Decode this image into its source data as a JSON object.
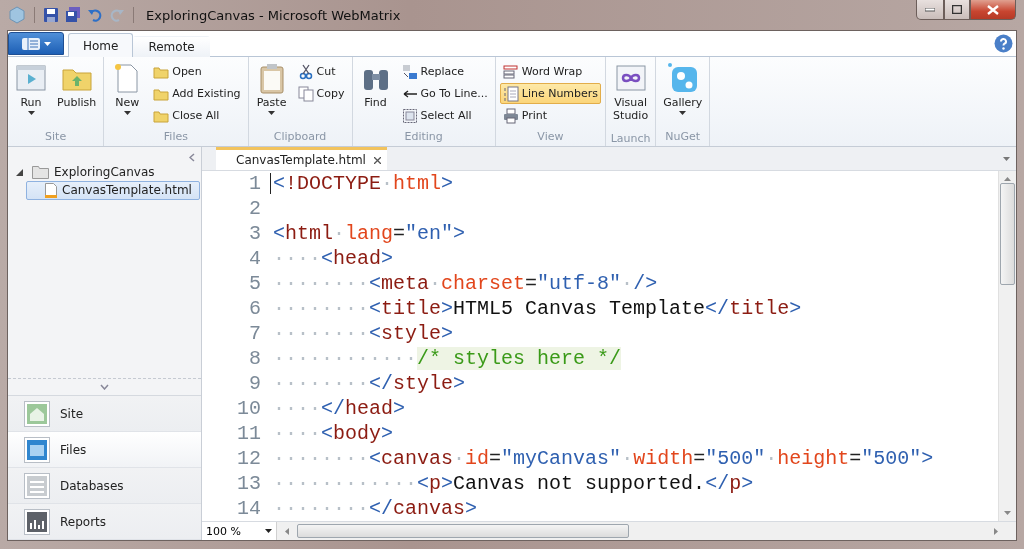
{
  "window": {
    "title": "ExploringCanvas - Microsoft WebMatrix"
  },
  "ribbon_tabs": [
    {
      "label": "Home",
      "selected": true
    },
    {
      "label": "Remote",
      "selected": false
    }
  ],
  "ribbon_groups": [
    {
      "label": "Site",
      "items": [
        {
          "kind": "large",
          "label": "Run",
          "dropdown": true
        },
        {
          "kind": "large",
          "label": "Publish",
          "dropdown": false
        }
      ]
    },
    {
      "label": "Files",
      "items": [
        {
          "kind": "large",
          "label": "New",
          "dropdown": true
        },
        {
          "kind": "stack",
          "entries": [
            {
              "label": "Open",
              "on": false
            },
            {
              "label": "Add Existing",
              "on": false
            },
            {
              "label": "Close All",
              "on": false
            }
          ]
        }
      ]
    },
    {
      "label": "Clipboard",
      "items": [
        {
          "kind": "large",
          "label": "Paste",
          "dropdown": true
        },
        {
          "kind": "stack",
          "entries": [
            {
              "label": "Cut",
              "on": false
            },
            {
              "label": "Copy",
              "on": false
            }
          ]
        }
      ]
    },
    {
      "label": "Editing",
      "items": [
        {
          "kind": "large",
          "label": "Find",
          "dropdown": false
        },
        {
          "kind": "stack",
          "entries": [
            {
              "label": "Replace",
              "on": false
            },
            {
              "label": "Go To Line...",
              "on": false
            },
            {
              "label": "Select All",
              "on": false
            }
          ]
        }
      ]
    },
    {
      "label": "View",
      "items": [
        {
          "kind": "stack",
          "entries": [
            {
              "label": "Word Wrap",
              "on": false
            },
            {
              "label": "Line Numbers",
              "on": true
            },
            {
              "label": "Print",
              "on": false
            }
          ]
        }
      ]
    },
    {
      "label": "Launch",
      "items": [
        {
          "kind": "large",
          "label": "Visual\nStudio",
          "dropdown": false
        }
      ]
    },
    {
      "label": "NuGet",
      "items": [
        {
          "kind": "large",
          "label": "Gallery",
          "dropdown": true
        }
      ]
    }
  ],
  "tree": [
    {
      "label": "ExploringCanvas",
      "expanded": true,
      "selected": false,
      "children": [
        {
          "label": "CanvasTemplate.html",
          "selected": true
        }
      ]
    }
  ],
  "workspaces": [
    {
      "label": "Site",
      "selected": false
    },
    {
      "label": "Files",
      "selected": true
    },
    {
      "label": "Databases",
      "selected": false
    },
    {
      "label": "Reports",
      "selected": false
    }
  ],
  "editor_tabs": [
    {
      "label": "CanvasTemplate.html",
      "selected": true
    }
  ],
  "code_lines": [
    {
      "number": "1",
      "tokens": [
        {
          "kind": "bracket",
          "text": "<"
        },
        {
          "kind": "tag",
          "text": "!DOCTYPE"
        },
        {
          "kind": "space",
          "text": "·"
        },
        {
          "kind": "attr",
          "text": "html"
        },
        {
          "kind": "bracket",
          "text": ">"
        }
      ]
    },
    {
      "number": "2"
    },
    {
      "number": "3",
      "tokens": [
        {
          "kind": "bracket",
          "text": "<"
        },
        {
          "kind": "tag",
          "text": "html"
        },
        {
          "kind": "space",
          "text": "·"
        },
        {
          "kind": "attr",
          "text": "lang"
        },
        {
          "kind": "eq",
          "text": "="
        },
        {
          "kind": "value",
          "text": "\"en\""
        },
        {
          "kind": "bracket",
          "text": ">"
        }
      ]
    },
    {
      "number": "4",
      "tokens": [
        {
          "kind": "space",
          "text": "····"
        },
        {
          "kind": "bracket",
          "text": "<"
        },
        {
          "kind": "tag",
          "text": "head"
        },
        {
          "kind": "bracket",
          "text": ">"
        }
      ]
    },
    {
      "number": "5",
      "tokens": [
        {
          "kind": "space",
          "text": "········"
        },
        {
          "kind": "bracket",
          "text": "<"
        },
        {
          "kind": "tag",
          "text": "meta"
        },
        {
          "kind": "space",
          "text": "·"
        },
        {
          "kind": "attr",
          "text": "charset"
        },
        {
          "kind": "eq",
          "text": "="
        },
        {
          "kind": "value",
          "text": "\"utf-8\""
        },
        {
          "kind": "space",
          "text": "·"
        },
        {
          "kind": "bracket",
          "text": "/>"
        }
      ]
    },
    {
      "number": "6",
      "tokens": [
        {
          "kind": "space",
          "text": "········"
        },
        {
          "kind": "bracket",
          "text": "<"
        },
        {
          "kind": "tag",
          "text": "title"
        },
        {
          "kind": "bracket",
          "text": ">"
        },
        {
          "kind": "text",
          "text": "HTML5 Canvas Template"
        },
        {
          "kind": "bracket",
          "text": "</"
        },
        {
          "kind": "tag",
          "text": "title"
        },
        {
          "kind": "bracket",
          "text": ">"
        }
      ]
    },
    {
      "number": "7",
      "tokens": [
        {
          "kind": "space",
          "text": "········"
        },
        {
          "kind": "bracket",
          "text": "<"
        },
        {
          "kind": "tag",
          "text": "style"
        },
        {
          "kind": "bracket",
          "text": ">"
        }
      ]
    },
    {
      "number": "8",
      "tokens": [
        {
          "kind": "space",
          "text": "············"
        },
        {
          "kind": "comment",
          "text": "/* styles here */"
        }
      ]
    },
    {
      "number": "9",
      "tokens": [
        {
          "kind": "space",
          "text": "········"
        },
        {
          "kind": "bracket",
          "text": "</"
        },
        {
          "kind": "tag",
          "text": "style"
        },
        {
          "kind": "bracket",
          "text": ">"
        }
      ]
    },
    {
      "number": "10",
      "tokens": [
        {
          "kind": "space",
          "text": "····"
        },
        {
          "kind": "bracket",
          "text": "</"
        },
        {
          "kind": "tag",
          "text": "head"
        },
        {
          "kind": "bracket",
          "text": ">"
        }
      ]
    },
    {
      "number": "11",
      "tokens": [
        {
          "kind": "space",
          "text": "····"
        },
        {
          "kind": "bracket",
          "text": "<"
        },
        {
          "kind": "tag",
          "text": "body"
        },
        {
          "kind": "bracket",
          "text": ">"
        }
      ]
    },
    {
      "number": "12",
      "tokens": [
        {
          "kind": "space",
          "text": "········"
        },
        {
          "kind": "bracket",
          "text": "<"
        },
        {
          "kind": "tag",
          "text": "canvas"
        },
        {
          "kind": "space",
          "text": "·"
        },
        {
          "kind": "attr",
          "text": "id"
        },
        {
          "kind": "eq",
          "text": "="
        },
        {
          "kind": "value",
          "text": "\"myCanvas\""
        },
        {
          "kind": "space",
          "text": "·"
        },
        {
          "kind": "attr",
          "text": "width"
        },
        {
          "kind": "eq",
          "text": "="
        },
        {
          "kind": "value",
          "text": "\"500\""
        },
        {
          "kind": "space",
          "text": "·"
        },
        {
          "kind": "attr",
          "text": "height"
        },
        {
          "kind": "eq",
          "text": "="
        },
        {
          "kind": "value",
          "text": "\"500\""
        },
        {
          "kind": "bracket",
          "text": ">"
        }
      ]
    },
    {
      "number": "13",
      "tokens": [
        {
          "kind": "space",
          "text": "············"
        },
        {
          "kind": "bracket",
          "text": "<"
        },
        {
          "kind": "tag",
          "text": "p"
        },
        {
          "kind": "bracket",
          "text": ">"
        },
        {
          "kind": "text",
          "text": "Canvas not supported."
        },
        {
          "kind": "bracket",
          "text": "</"
        },
        {
          "kind": "tag",
          "text": "p"
        },
        {
          "kind": "bracket",
          "text": ">"
        }
      ]
    },
    {
      "number": "14",
      "tokens": [
        {
          "kind": "space",
          "text": "········"
        },
        {
          "kind": "bracket",
          "text": "</"
        },
        {
          "kind": "tag",
          "text": "canvas"
        },
        {
          "kind": "bracket",
          "text": ">"
        }
      ]
    }
  ],
  "zoom": {
    "value": "100 %"
  }
}
